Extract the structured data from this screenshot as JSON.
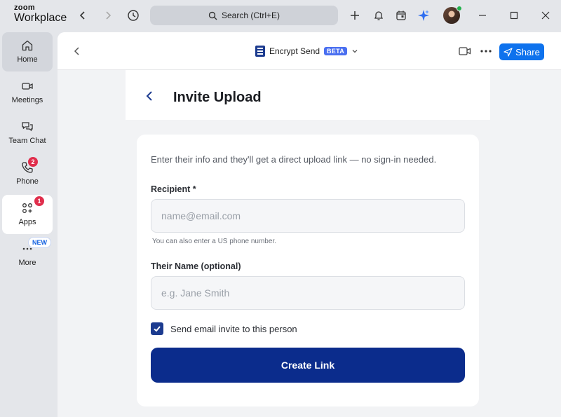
{
  "app": {
    "brand_top": "zoom",
    "brand_bottom": "Workplace"
  },
  "titlebar": {
    "search_label": "Search (Ctrl+E)"
  },
  "sidebar": {
    "items": [
      {
        "label": "Home"
      },
      {
        "label": "Meetings"
      },
      {
        "label": "Team Chat"
      },
      {
        "label": "Phone",
        "badge": "2"
      },
      {
        "label": "Apps",
        "badge": "1"
      },
      {
        "label": "More",
        "tag": "NEW"
      }
    ]
  },
  "header": {
    "app_name": "Encrypt Send",
    "beta": "BETA",
    "share_label": "Share"
  },
  "page": {
    "title": "Invite Upload",
    "intro": "Enter their info and they'll get a direct upload link — no sign-in needed.",
    "recipient_label": "Recipient *",
    "recipient_placeholder": "name@email.com",
    "recipient_hint": "You can also enter a US phone number.",
    "name_label": "Their Name (optional)",
    "name_placeholder": "e.g. Jane Smith",
    "checkbox_label": "Send email invite to this person",
    "checkbox_checked": true,
    "create_label": "Create Link"
  },
  "colors": {
    "accent": "#0e72ed",
    "primary": "#0b2c8c",
    "badge": "#e02e4c"
  }
}
